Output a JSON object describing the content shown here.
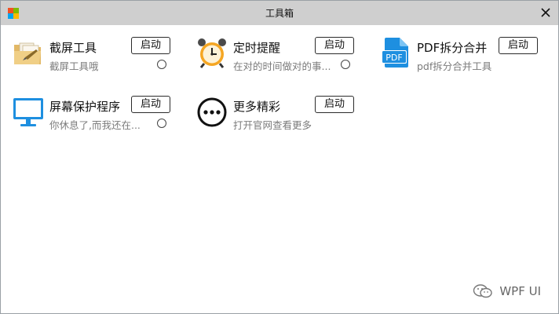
{
  "window": {
    "title": "工具箱"
  },
  "tools": [
    {
      "name": "截屏工具",
      "desc": "截屏工具哦",
      "button": "启动",
      "icon": "screenshot-folder-icon",
      "has_radio": true
    },
    {
      "name": "定时提醒",
      "desc": "在对的时间做对的事...",
      "button": "启动",
      "icon": "alarm-clock-icon",
      "has_radio": true
    },
    {
      "name": "PDF拆分合并",
      "desc": "pdf拆分合并工具",
      "button": "启动",
      "icon": "pdf-file-icon",
      "has_radio": false
    },
    {
      "name": "屏幕保护程序",
      "desc": "你休息了,而我还在...",
      "button": "启动",
      "icon": "monitor-icon",
      "has_radio": true
    },
    {
      "name": "更多精彩",
      "desc": "打开官网查看更多",
      "button": "启动",
      "icon": "more-dots-icon",
      "has_radio": false
    }
  ],
  "watermark": "WPF UI",
  "colors": {
    "titlebar": "#cfcfcf",
    "accent_blue": "#1e8fe0",
    "clock_orange": "#f5a623"
  }
}
